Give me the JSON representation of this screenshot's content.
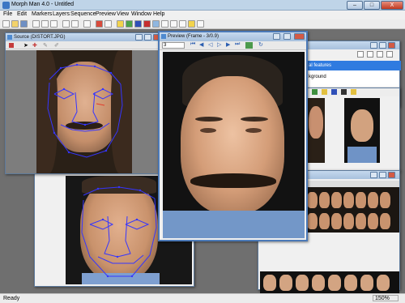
{
  "app": {
    "title": "Morph Man 4.0 - Untitled"
  },
  "window_buttons": {
    "minimize": "–",
    "maximize": "□",
    "close": "X"
  },
  "menu": [
    "File",
    "Edit",
    "Markers",
    "Layers",
    "Sequence",
    "Preview",
    "View",
    "Window",
    "Help"
  ],
  "source_window": {
    "title": "Source (DISTORT.JPG)"
  },
  "preview_window": {
    "title": "Preview (Frame - 3/0.9)",
    "frame_value": "3"
  },
  "layers_panel": {
    "items": [
      "al features",
      "kground"
    ]
  },
  "status_bar": {
    "left": "Ready",
    "zoom": "150%"
  },
  "colors": {
    "title_bar": "#bfd4e8",
    "accent": "#3b77c4",
    "selected_layer": "#2f7be0",
    "marker": "#3535ff"
  }
}
